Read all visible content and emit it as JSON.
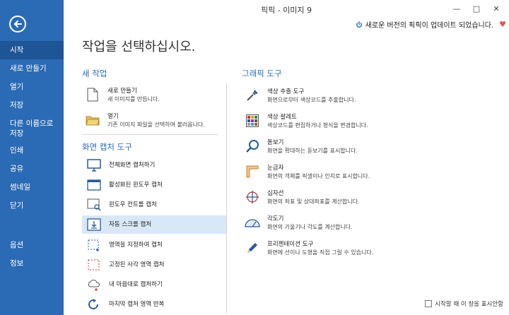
{
  "window": {
    "title": "픽픽 - 이미지 9",
    "controls": [
      "—",
      "□",
      "✕"
    ]
  },
  "update": {
    "text": "새로운 버전의 픽픽이 업데이트 되었습니다."
  },
  "heading": "작업을 선택하십시오.",
  "sidebar": {
    "items": [
      {
        "label": "시작",
        "active": true
      },
      {
        "label": "새로 만들기"
      },
      {
        "label": "열기"
      },
      {
        "label": "저장"
      },
      {
        "label": "다른 이름으로\n저장"
      },
      {
        "label": "인쇄"
      },
      {
        "label": "공유"
      },
      {
        "label": "썸네일"
      },
      {
        "label": "닫기"
      },
      {
        "label": "옵션"
      },
      {
        "label": "정보"
      }
    ]
  },
  "new_work": {
    "title": "새 작업",
    "items": [
      {
        "label": "새로 만들기",
        "desc": "새 이미지를 만듭니다."
      },
      {
        "label": "열기",
        "desc": "기존 이미지 파일을 선택하여 불러옵니다."
      }
    ]
  },
  "capture": {
    "title": "화면 캡처 도구",
    "items": [
      {
        "label": "전체화면 캡처하기"
      },
      {
        "label": "활성화된 윈도우 캡처"
      },
      {
        "label": "윈도우 컨트롤 캡처"
      },
      {
        "label": "자동 스크롤 캡처",
        "selected": true
      },
      {
        "label": "영역을 지정하여 캡처"
      },
      {
        "label": "고정된 사각 영역 캡처"
      },
      {
        "label": "내 마음대로 캡처하기"
      },
      {
        "label": "마지막 캡처 영역 반복"
      }
    ]
  },
  "graphic": {
    "title": "그래픽 도구",
    "items": [
      {
        "label": "색상 추출 도구",
        "desc": "화면으로부터 색상코드를 추출합니다."
      },
      {
        "label": "색상 팔레트",
        "desc": "색상코드를 편집하거나 형식을 변경합니다."
      },
      {
        "label": "돋보기",
        "desc": "화면을 확대하는 돋보기를 표시합니다."
      },
      {
        "label": "눈금자",
        "desc": "화면의 객체를 픽셀이나 인치로 표시합니다."
      },
      {
        "label": "십자선",
        "desc": "화면의 좌표 및 상대좌표를 계산합니다."
      },
      {
        "label": "각도기",
        "desc": "화면의 기울기나 각도를 계산합니다."
      },
      {
        "label": "프리젠테이션 도구",
        "desc": "화면에 선이나 도형을 직접 그릴 수 있습니다."
      }
    ]
  },
  "footer": {
    "checkbox_label": "시작할 때 이 창을 표시안함"
  },
  "colors": {
    "sidebar": "#2b6bb5",
    "accent": "#2b6bb5",
    "selection": "#d9e8f7"
  }
}
